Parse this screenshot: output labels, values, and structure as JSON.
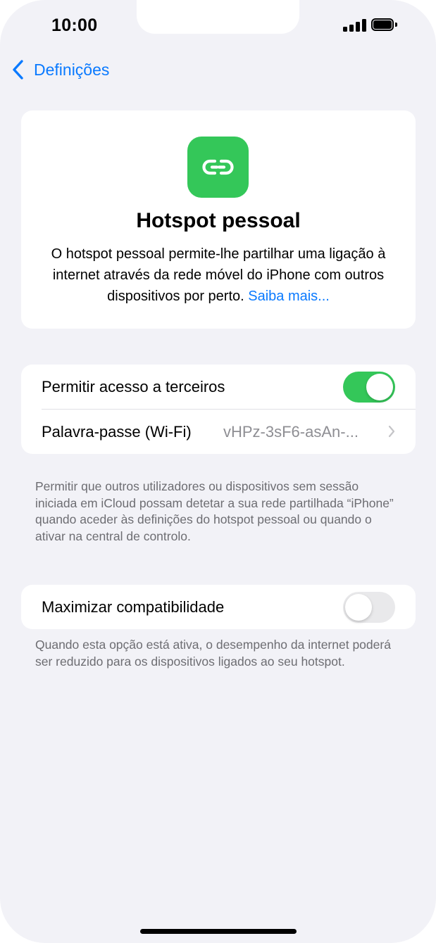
{
  "status_bar": {
    "time": "10:00",
    "signal_icon": "cellular-signal-icon",
    "battery_icon": "battery-full-icon"
  },
  "nav": {
    "back_label": "Definições",
    "back_icon": "chevron-left-icon"
  },
  "hero": {
    "icon": "link-icon",
    "icon_color": "#34c759",
    "title": "Hotspot pessoal",
    "description": "O hotspot pessoal permite-lhe partilhar uma ligação à internet através da rede móvel do iPhone com outros dispositivos por perto.",
    "learn_more": "Saiba mais..."
  },
  "sharing": {
    "allow_others_label": "Permitir acesso a terceiros",
    "allow_others_on": true,
    "password_label": "Palavra-passe (Wi-Fi)",
    "password_value": "vHPz-3sF6-asAn-...",
    "footer": "Permitir que outros utilizadores ou dispositivos sem sessão iniciada em iCloud possam detetar a sua rede partilhada “iPhone” quando aceder às definições do hotspot pessoal ou quando o ativar na central de controlo."
  },
  "compatibility": {
    "maximize_label": "Maximizar compatibilidade",
    "maximize_on": false,
    "footer": "Quando esta opção está ativa, o desempenho da internet poderá ser reduzido para os dispositivos ligados ao seu hotspot."
  },
  "colors": {
    "accent": "#0a7aff",
    "toggle_on": "#34c759",
    "background": "#f2f2f7"
  }
}
